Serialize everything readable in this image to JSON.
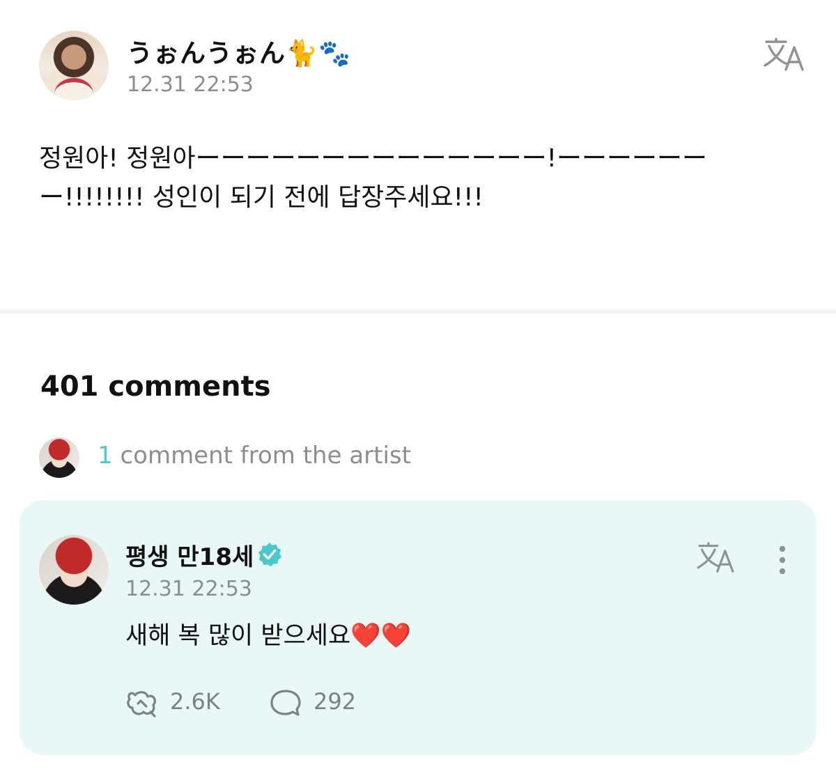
{
  "post": {
    "author_name": "うぉんうぉん🐈🐾",
    "timestamp": "12.31 22:53",
    "body": "정원아! 정원아ーーーーーーーーーーーーーー!ーーーーーーー!!!!!!!! 성인이 되기 전에 답장주세요!!!",
    "avatar_icon": "user-avatar",
    "translate_icon": "translate-icon"
  },
  "comments": {
    "count_label": "401 comments",
    "artist_comments_count": "1",
    "artist_comments_label": " comment from the artist"
  },
  "artist_comment": {
    "author_name": "평생 만18세",
    "verified_icon": "verified-badge-icon",
    "timestamp": "12.31 22:53",
    "text": "새해 복 많이 받으세요",
    "text_emoji": "❤️❤️",
    "likes": "2.6K",
    "replies": "292",
    "like_icon": "like-icon",
    "reply_icon": "comment-bubble-icon",
    "more_icon": "more-options-icon"
  },
  "colors": {
    "accent_teal": "#4bc8c9",
    "card_background": "#e9f8f6",
    "muted_text": "#8a8d91",
    "heart": "#e0262b"
  }
}
